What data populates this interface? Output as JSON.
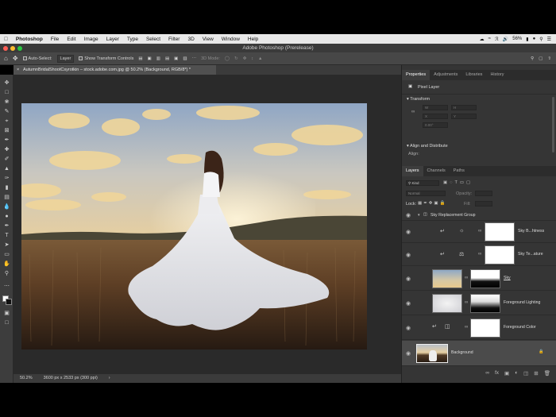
{
  "menubar": {
    "apple": "",
    "app_name": "Photoshop",
    "items": [
      "File",
      "Edit",
      "Image",
      "Layer",
      "Type",
      "Select",
      "Filter",
      "3D",
      "View",
      "Window",
      "Help"
    ],
    "battery": "56%"
  },
  "window": {
    "title": "Adobe Photoshop (Prerelease)"
  },
  "options_bar": {
    "auto_select_label": "Auto-Select:",
    "auto_select_value": "Layer",
    "show_transform_label": "Show Transform Controls",
    "mode_3d_label": "3D Mode:"
  },
  "document_tab": {
    "title": "AutumnBridalShootCsyrotkin – stock.adobe.com.jpg @ 50.2% (Background, RGB/8*) *"
  },
  "status_bar": {
    "zoom": "50.2%",
    "doc_info": "3600 px x 2533 px (300 ppi)",
    "arrow": "›"
  },
  "properties_panel": {
    "tabs": [
      "Properties",
      "Adjustments",
      "Libraries",
      "History"
    ],
    "active_tab": "Properties",
    "layer_type": "Pixel Layer",
    "transform_label": "Transform",
    "align_label": "Align and Distribute",
    "align_sub": "Align:",
    "fields": [
      "W",
      "H",
      "X",
      "Y",
      "0.00°"
    ]
  },
  "layers_panel": {
    "tabs": [
      "Layers",
      "Channels",
      "Paths"
    ],
    "active_tab": "Layers",
    "kind_label": "Kind",
    "blend_mode": "Normal",
    "opacity_label": "Opacity:",
    "lock_label": "Lock:",
    "fill_label": "Fill:",
    "layers": [
      {
        "name": "Sky Replacement Group",
        "kind": "group"
      },
      {
        "name": "Sky B...htness",
        "kind": "adjustment"
      },
      {
        "name": "Sky Te...ature",
        "kind": "adjustment"
      },
      {
        "name": "Sky",
        "kind": "pixel"
      },
      {
        "name": "Foreground Lighting",
        "kind": "pixel"
      },
      {
        "name": "Foreground Color",
        "kind": "fill"
      },
      {
        "name": "Background",
        "kind": "background"
      }
    ]
  },
  "colors": {
    "canvas_bg": "#2a2a2a",
    "panel_bg": "#353535",
    "selected_layer": "#4b4b4b"
  }
}
